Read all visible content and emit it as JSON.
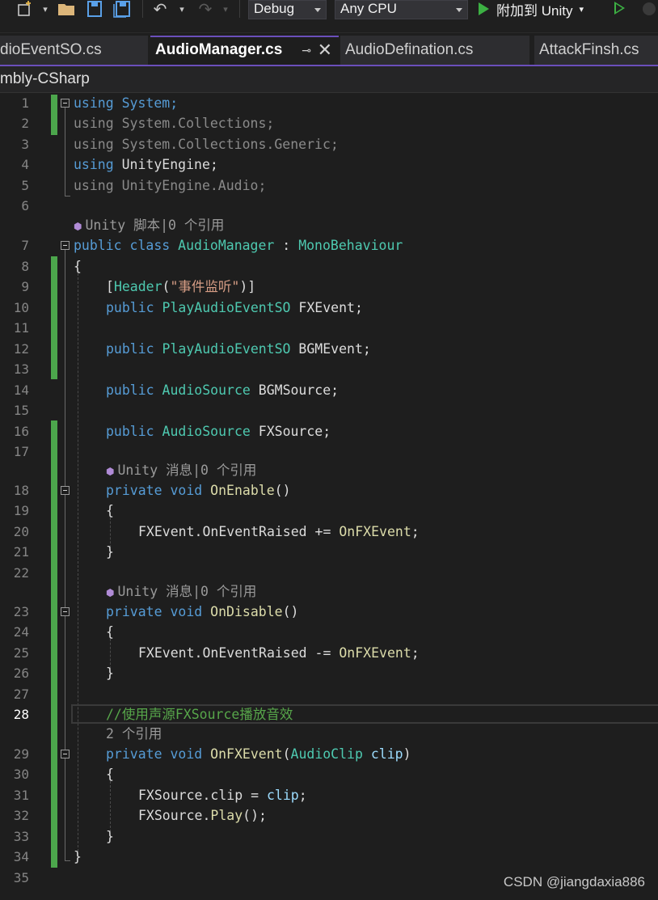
{
  "toolbar": {
    "icons": [
      "new-project-icon",
      "open-folder-icon",
      "save-icon",
      "save-all-icon",
      "undo-icon",
      "redo-icon"
    ],
    "config": "Debug",
    "platform": "Any CPU",
    "attach_label": "附加到 Unity"
  },
  "tabs": [
    {
      "label": "dioEventSO.cs",
      "active": false
    },
    {
      "label": "AudioManager.cs",
      "active": true
    },
    {
      "label": "AudioDefination.cs",
      "active": false
    },
    {
      "label": "AttackFinsh.cs",
      "active": false
    }
  ],
  "nav": {
    "project": "mbly-CSharp"
  },
  "editor": {
    "current_line": 28,
    "lines": [
      {
        "n": "1",
        "code": "using System;"
      },
      {
        "n": "2",
        "code": "using System.Collections;"
      },
      {
        "n": "3",
        "code": "using System.Collections.Generic;"
      },
      {
        "n": "4",
        "code": "using UnityEngine;"
      },
      {
        "n": "5",
        "code": "using UnityEngine.Audio;"
      },
      {
        "n": "6",
        "code": ""
      },
      {
        "lens": "Unity 脚本|0 个引用"
      },
      {
        "n": "7",
        "code": "public class AudioManager : MonoBehaviour"
      },
      {
        "n": "8",
        "code": "{"
      },
      {
        "n": "9",
        "code": "[Header(\"事件监听\")]"
      },
      {
        "n": "10",
        "code": "public PlayAudioEventSO FXEvent;"
      },
      {
        "n": "11",
        "code": ""
      },
      {
        "n": "12",
        "code": "public PlayAudioEventSO BGMEvent;"
      },
      {
        "n": "13",
        "code": ""
      },
      {
        "n": "14",
        "code": "public AudioSource BGMSource;"
      },
      {
        "n": "15",
        "code": ""
      },
      {
        "n": "16",
        "code": "public AudioSource FXSource;"
      },
      {
        "n": "17",
        "code": ""
      },
      {
        "lens": "Unity 消息|0 个引用"
      },
      {
        "n": "18",
        "code": "private void OnEnable()"
      },
      {
        "n": "19",
        "code": "{"
      },
      {
        "n": "20",
        "code": "FXEvent.OnEventRaised += OnFXEvent;"
      },
      {
        "n": "21",
        "code": "}"
      },
      {
        "n": "22",
        "code": ""
      },
      {
        "lens": "Unity 消息|0 个引用"
      },
      {
        "n": "23",
        "code": "private void OnDisable()"
      },
      {
        "n": "24",
        "code": "{"
      },
      {
        "n": "25",
        "code": "FXEvent.OnEventRaised -= OnFXEvent;"
      },
      {
        "n": "26",
        "code": "}"
      },
      {
        "n": "27",
        "code": ""
      },
      {
        "n": "28",
        "code": "//使用声源FXSource播放音效"
      },
      {
        "lens": "2 个引用"
      },
      {
        "n": "29",
        "code": "private void OnFXEvent(AudioClip clip)"
      },
      {
        "n": "30",
        "code": "{"
      },
      {
        "n": "31",
        "code": "FXSource.clip = clip;"
      },
      {
        "n": "32",
        "code": "FXSource.Play();"
      },
      {
        "n": "33",
        "code": "}"
      },
      {
        "n": "34",
        "code": "}"
      },
      {
        "n": "35",
        "code": ""
      }
    ]
  },
  "watermark": "CSDN @jiangdaxia886"
}
